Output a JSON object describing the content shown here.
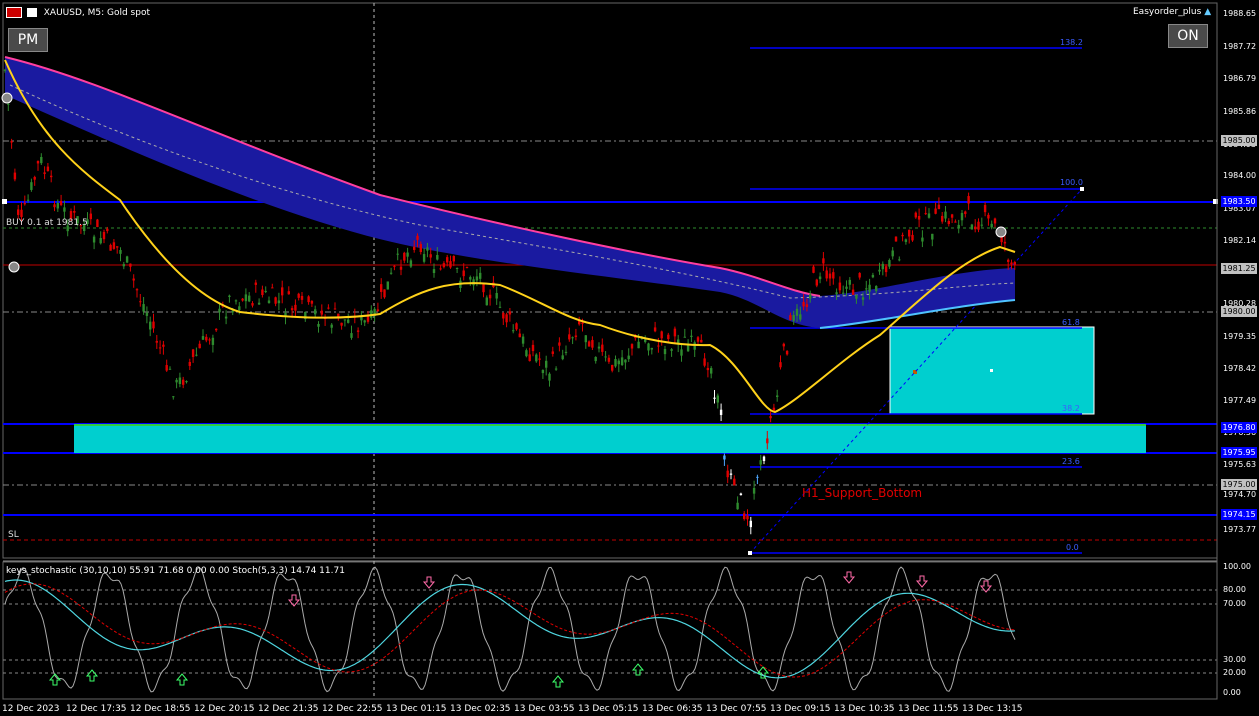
{
  "window": {
    "symbol_title": "XAUUSD, M5:  Gold spot",
    "ea_name": "Easyorder_plus"
  },
  "buttons": {
    "pm": "PM",
    "on": "ON"
  },
  "chart_labels": {
    "buy_label": "BUY 0.1 at 1981.5",
    "sl_label": "SL",
    "support_label": "H1_Support_Bottom"
  },
  "indicator_text": "keys_stochastic (30,10,10) 55.91 71.68 0.00 0.00 Stoch(5,3,3) 14.74 11.71",
  "price_axis": [
    "1988.65",
    "1987.72",
    "1986.79",
    "1985.86",
    "1984.93",
    "1984.00",
    "1983.07",
    "1982.14",
    "1981.21",
    "1980.28",
    "1979.35",
    "1978.42",
    "1977.49",
    "1976.56",
    "1975.63",
    "1974.70",
    "1973.77"
  ],
  "price_tags": [
    {
      "label": "1985.00",
      "bg": "#c0c0c0",
      "fg": "#000"
    },
    {
      "label": "1983.50",
      "bg": "#0000ff",
      "fg": "#fff"
    },
    {
      "label": "1981.25",
      "bg": "#c0c0c0",
      "fg": "#000"
    },
    {
      "label": "1980.00",
      "bg": "#c0c0c0",
      "fg": "#000"
    },
    {
      "label": "1976.80",
      "bg": "#0000ff",
      "fg": "#fff"
    },
    {
      "label": "1975.95",
      "bg": "#0000ff",
      "fg": "#fff"
    },
    {
      "label": "1975.00",
      "bg": "#c0c0c0",
      "fg": "#000"
    },
    {
      "label": "1974.15",
      "bg": "#0000ff",
      "fg": "#fff"
    }
  ],
  "fib_levels": [
    "138.2",
    "100.0",
    "61.8",
    "38.2",
    "23.6",
    "0.0"
  ],
  "stoch_axis": [
    "100.00",
    "80.00",
    "70.00",
    "30.00",
    "20.00",
    "0.00"
  ],
  "time_axis": [
    "12 Dec 2023",
    "12 Dec 17:35",
    "12 Dec 18:55",
    "12 Dec 20:15",
    "12 Dec 21:35",
    "12 Dec 22:55",
    "13 Dec 01:15",
    "13 Dec 02:35",
    "13 Dec 03:55",
    "13 Dec 05:15",
    "13 Dec 06:35",
    "13 Dec 07:55",
    "13 Dec 09:15",
    "13 Dec 10:35",
    "13 Dec 11:55",
    "13 Dec 13:15"
  ],
  "colors": {
    "bull": "#2e8b2e",
    "bear": "#e00000",
    "ma_yellow": "#ffd21a",
    "cloud": "#1a1aa0",
    "cloud_edge": "#ff3fa0",
    "zone": "#00cfcf",
    "level_blue": "#0000ff"
  }
}
